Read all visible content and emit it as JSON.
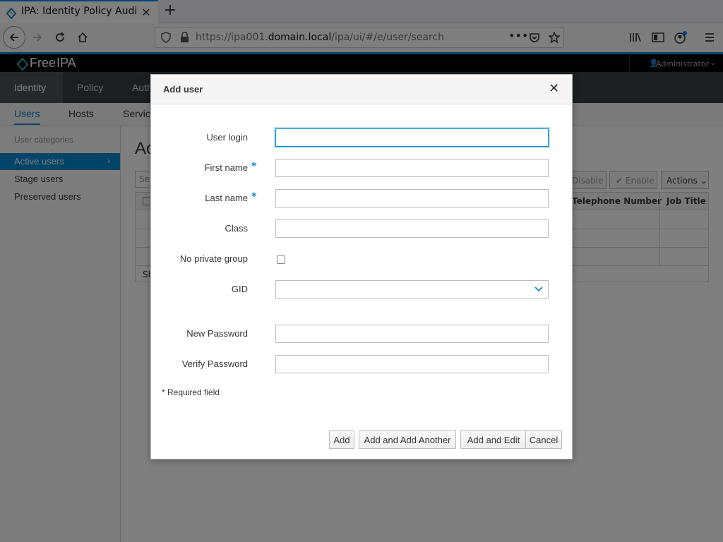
{
  "browser": {
    "tab_title": "IPA: Identity Policy Audit",
    "url_prefix": "https://ipa001.",
    "url_domain": "domain.local",
    "url_path": "/ipa/ui/#/e/user/search"
  },
  "app": {
    "brand_light": "Free",
    "brand_bold": "IPA",
    "user_menu": "Administrator",
    "main_nav": [
      "Identity",
      "Policy",
      "Auth"
    ],
    "sub_nav": [
      "Users",
      "Hosts",
      "Servic"
    ],
    "sidebar": {
      "heading": "User categories",
      "items": [
        "Active users",
        "Stage users",
        "Preserved users"
      ]
    },
    "page_title": "Ac",
    "toolbar": {
      "search_placeholder": "Se",
      "disable": "Disable",
      "enable": "Enable",
      "actions": "Actions"
    },
    "table": {
      "col_telephone": "Telephone Number",
      "col_job": "Job Title",
      "footer": "Sh"
    }
  },
  "dialog": {
    "title": "Add user",
    "fields": {
      "user_login": {
        "label": "User login",
        "value": ""
      },
      "first_name": {
        "label": "First name",
        "value": ""
      },
      "last_name": {
        "label": "Last name",
        "value": ""
      },
      "class": {
        "label": "Class",
        "value": ""
      },
      "no_private_group": {
        "label": "No private group",
        "checked": false
      },
      "gid": {
        "label": "GID",
        "value": ""
      },
      "new_password": {
        "label": "New Password",
        "value": ""
      },
      "verify_password": {
        "label": "Verify Password",
        "value": ""
      }
    },
    "required_marker": "*",
    "required_note": "* Required field",
    "buttons": {
      "add": "Add",
      "add_another": "Add and Add Another",
      "add_edit": "Add and Edit",
      "cancel": "Cancel"
    }
  },
  "colors": {
    "accent": "#0088ce",
    "header_bg": "#030303",
    "nav_bg": "#393f44",
    "overlay": "rgba(0,0,0,0.5)"
  }
}
